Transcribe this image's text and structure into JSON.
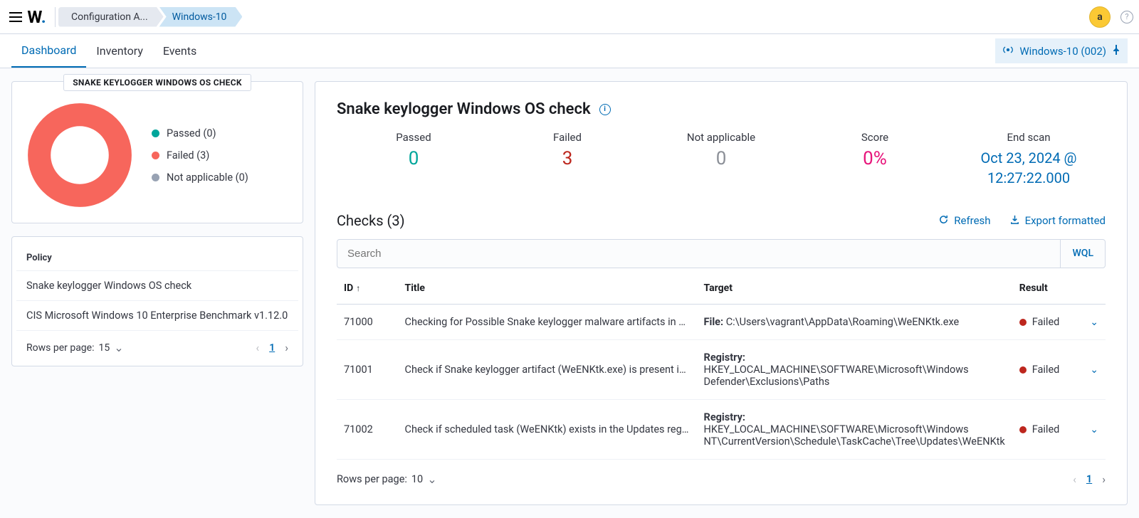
{
  "colors": {
    "teal": "#00a69b",
    "red": "#f7665c",
    "grey": "#98a2b3",
    "blue": "#006bb4",
    "magenta": "#e7157b",
    "failedText": "#bd271e"
  },
  "topbar": {
    "logo": "W",
    "breadcrumb": [
      {
        "label": "Configuration A..."
      },
      {
        "label": "Windows-10"
      }
    ],
    "avatar": "a"
  },
  "tabs": {
    "items": [
      "Dashboard",
      "Inventory",
      "Events"
    ],
    "activeIndex": 0,
    "agentPill": "Windows-10 (002)"
  },
  "donut": {
    "title": "SNAKE KEYLOGGER WINDOWS OS CHECK",
    "legend": [
      {
        "label": "Passed (0)",
        "color": "#00a69b"
      },
      {
        "label": "Failed (3)",
        "color": "#f7665c"
      },
      {
        "label": "Not applicable (0)",
        "color": "#98a2b3"
      }
    ]
  },
  "policy": {
    "heading": "Policy",
    "rows": [
      "Snake keylogger Windows OS check",
      "CIS Microsoft Windows 10 Enterprise Benchmark v1.12.0"
    ],
    "rppLabel": "Rows per page:",
    "rppValue": "15",
    "page": "1"
  },
  "main": {
    "title": "Snake keylogger Windows OS check",
    "metrics": {
      "passed": {
        "label": "Passed",
        "value": "0"
      },
      "failed": {
        "label": "Failed",
        "value": "3"
      },
      "na": {
        "label": "Not applicable",
        "value": "0"
      },
      "score": {
        "label": "Score",
        "value": "0%"
      },
      "end": {
        "label": "End scan",
        "value_l1": "Oct 23, 2024 @",
        "value_l2": "12:27:22.000"
      }
    },
    "checks": {
      "title": "Checks (3)",
      "refresh": "Refresh",
      "export": "Export formatted",
      "searchPlaceholder": "Search",
      "wql": "WQL",
      "columns": {
        "id": "ID",
        "title": "Title",
        "target": "Target",
        "result": "Result"
      },
      "rows": [
        {
          "id": "71000",
          "title": "Checking for Possible Snake keylogger malware artifacts in Roa...",
          "targetLabel": "File:",
          "targetValue": "C:\\Users\\vagrant\\AppData\\Roaming\\WeENKtk.exe",
          "result": "Failed"
        },
        {
          "id": "71001",
          "title": "Check if Snake keylogger artifact (WeENKtk.exe) is present in ...",
          "targetLabel": "Registry:",
          "targetValue": "HKEY_LOCAL_MACHINE\\SOFTWARE\\Microsoft\\Windows Defender\\Exclusions\\Paths",
          "result": "Failed"
        },
        {
          "id": "71002",
          "title": "Check if scheduled task (WeENKtk) exists in the Updates regist...",
          "targetLabel": "Registry:",
          "targetValue": "HKEY_LOCAL_MACHINE\\SOFTWARE\\Microsoft\\Windows NT\\CurrentVersion\\Schedule\\TaskCache\\Tree\\Updates\\WeENKtk",
          "result": "Failed"
        }
      ],
      "rppLabel": "Rows per page:",
      "rppValue": "10",
      "page": "1"
    }
  },
  "chart_data": {
    "type": "pie",
    "title": "SNAKE KEYLOGGER WINDOWS OS CHECK",
    "series": [
      {
        "name": "Passed",
        "value": 0,
        "color": "#00a69b"
      },
      {
        "name": "Failed",
        "value": 3,
        "color": "#f7665c"
      },
      {
        "name": "Not applicable",
        "value": 0,
        "color": "#98a2b3"
      }
    ]
  }
}
